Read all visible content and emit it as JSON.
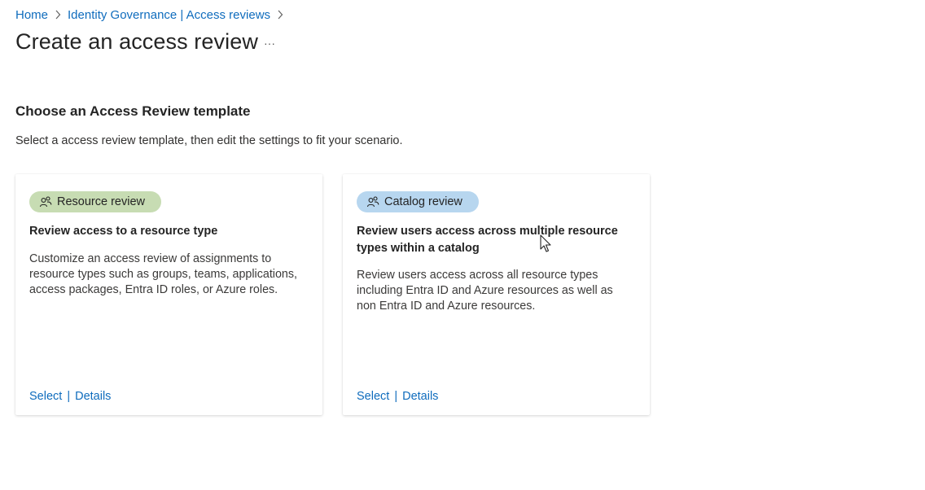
{
  "breadcrumb": {
    "items": [
      {
        "label": "Home"
      },
      {
        "label": "Identity Governance | Access reviews"
      }
    ]
  },
  "page": {
    "title": "Create an access review",
    "more_label": "···"
  },
  "section": {
    "title": "Choose an Access Review template",
    "subtitle": "Select a access review template, then edit the settings to fit your scenario."
  },
  "cards": [
    {
      "tag": "Resource review",
      "tag_color": "#c7dcb3",
      "title": "Review access to a resource type",
      "description": "Customize an access review of assignments to resource types such as groups, teams, applications, access packages, Entra ID roles, or Azure roles.",
      "select_label": "Select",
      "separator": "|",
      "details_label": "Details"
    },
    {
      "tag": "Catalog review",
      "tag_color": "#b7d6ef",
      "title": "Review users access across multiple resource types within a catalog",
      "description": "Review users access across all resource types including Entra ID and Azure resources as well as non Entra ID and Azure resources.",
      "select_label": "Select",
      "separator": "|",
      "details_label": "Details"
    }
  ],
  "colors": {
    "link": "#0f6cbd",
    "text": "#242424"
  }
}
